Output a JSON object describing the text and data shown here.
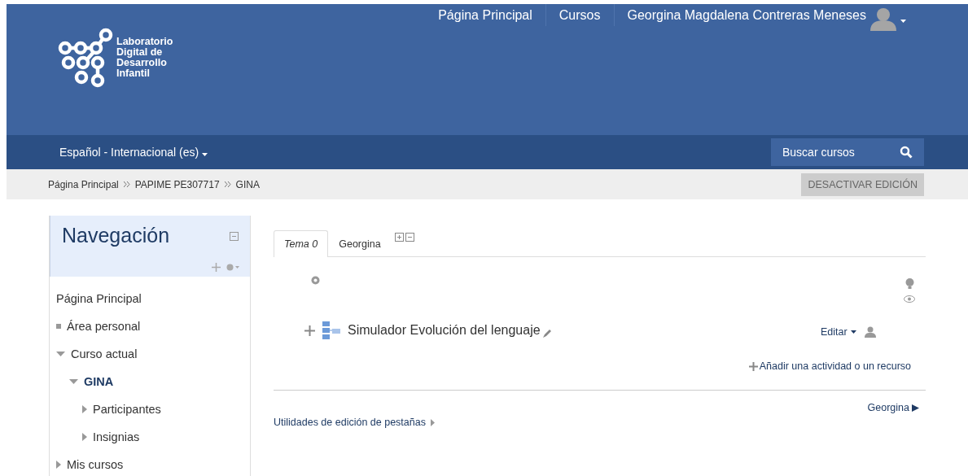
{
  "header": {
    "logo_lines": [
      "Laboratorio",
      "Digital de",
      "Desarrollo",
      "Infantil"
    ],
    "top_links": [
      "Página Principal",
      "Cursos"
    ],
    "user_name": "Georgina Magdalena Contreras Meneses"
  },
  "lang_bar": {
    "language": "Español - Internacional (es)",
    "search_button": "Buscar cursos"
  },
  "breadcrumb": {
    "items": [
      "Página Principal",
      "PAPIME PE307717",
      "GINA"
    ],
    "edit_button": "DESACTIVAR EDICIÓN"
  },
  "navigation": {
    "title": "Navegación",
    "items": [
      {
        "label": "Página Principal",
        "kind": "plain"
      },
      {
        "label": "Área personal",
        "kind": "leaf"
      },
      {
        "label": "Curso actual",
        "kind": "branch",
        "expanded": true,
        "children": [
          {
            "label": "GINA",
            "kind": "branch",
            "expanded": true,
            "current": true,
            "children": [
              {
                "label": "Participantes",
                "kind": "branch",
                "expanded": false
              },
              {
                "label": "Insignias",
                "kind": "branch",
                "expanded": false
              }
            ]
          }
        ]
      },
      {
        "label": "Mis cursos",
        "kind": "branch",
        "expanded": false
      }
    ]
  },
  "course": {
    "tabs": [
      {
        "label": "Tema 0",
        "selected": true
      },
      {
        "label": "Georgina",
        "selected": false
      }
    ],
    "activity": {
      "name": "Simulador Evolución del lenguaje",
      "edit_menu": "Editar"
    },
    "add_link": "Añadir una actividad o un recurso",
    "next_section": "Georgina",
    "tab_utilities": "Utilidades de edición de pestañas"
  }
}
